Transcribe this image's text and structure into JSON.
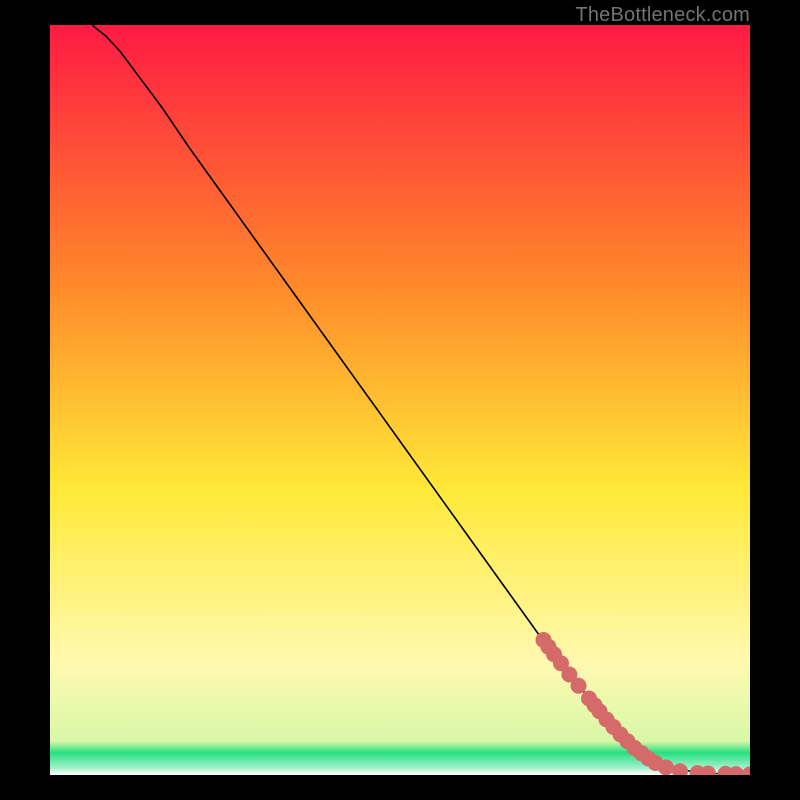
{
  "watermark": "TheBottleneck.com",
  "colors": {
    "frame": "#000000",
    "curve": "#000000",
    "marker_fill": "#d56a6a",
    "marker_stroke": "#d56a6a",
    "gradient_top": "#ff1a44",
    "gradient_mid_upper": "#ff8a2a",
    "gradient_mid": "#ffe938",
    "gradient_mid_lower": "#fff9b0",
    "gradient_green": "#26e07f",
    "gradient_bottom": "#ffffff"
  },
  "chart_data": {
    "type": "line",
    "title": "",
    "xlabel": "",
    "ylabel": "",
    "xlim": [
      0,
      100
    ],
    "ylim": [
      0,
      100
    ],
    "series": [
      {
        "name": "curve",
        "x": [
          6,
          8,
          10,
          12,
          16,
          20,
          25,
          30,
          35,
          40,
          45,
          50,
          55,
          60,
          65,
          70,
          75,
          80,
          85,
          88,
          90,
          92,
          95,
          98,
          100
        ],
        "y": [
          100,
          98.5,
          96.5,
          94,
          89,
          83.5,
          77,
          70.5,
          64,
          57.5,
          51,
          44.5,
          38,
          31.5,
          25,
          18.5,
          12.5,
          7,
          3,
          1.5,
          0.8,
          0.4,
          0.2,
          0.1,
          0.1
        ]
      }
    ],
    "markers": [
      {
        "x": 70.5,
        "y": 18.0
      },
      {
        "x": 71.2,
        "y": 17.1
      },
      {
        "x": 72.0,
        "y": 16.1
      },
      {
        "x": 73.0,
        "y": 14.9
      },
      {
        "x": 74.2,
        "y": 13.4
      },
      {
        "x": 75.5,
        "y": 11.9
      },
      {
        "x": 77.0,
        "y": 10.2
      },
      {
        "x": 77.8,
        "y": 9.3
      },
      {
        "x": 78.5,
        "y": 8.5
      },
      {
        "x": 79.5,
        "y": 7.4
      },
      {
        "x": 80.5,
        "y": 6.4
      },
      {
        "x": 81.5,
        "y": 5.4
      },
      {
        "x": 82.5,
        "y": 4.5
      },
      {
        "x": 83.5,
        "y": 3.6
      },
      {
        "x": 84.5,
        "y": 2.9
      },
      {
        "x": 85.5,
        "y": 2.2
      },
      {
        "x": 86.5,
        "y": 1.6
      },
      {
        "x": 88.0,
        "y": 1.0
      },
      {
        "x": 90.0,
        "y": 0.5
      },
      {
        "x": 92.5,
        "y": 0.25
      },
      {
        "x": 94.0,
        "y": 0.2
      },
      {
        "x": 96.5,
        "y": 0.15
      },
      {
        "x": 98.0,
        "y": 0.12
      },
      {
        "x": 100.0,
        "y": 0.1
      }
    ]
  }
}
